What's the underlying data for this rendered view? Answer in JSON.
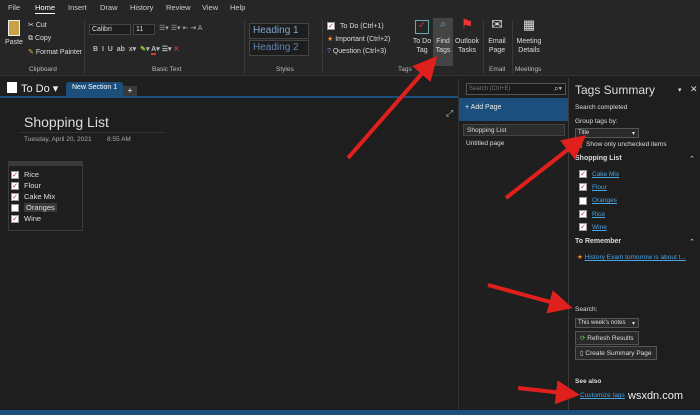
{
  "menu": [
    "File",
    "Home",
    "Insert",
    "Draw",
    "History",
    "Review",
    "View",
    "Help"
  ],
  "clipboard": {
    "paste": "Paste",
    "cut": "Cut",
    "copy": "Copy",
    "format_painter": "Format Painter",
    "label": "Clipboard"
  },
  "basic_text": {
    "font": "Calibri",
    "size": "11",
    "label": "Basic Text"
  },
  "styles": {
    "h1": "Heading 1",
    "h2": "Heading 2",
    "label": "Styles"
  },
  "tags": {
    "items": [
      "To Do (Ctrl+1)",
      "Important (Ctrl+2)",
      "Question (Ctrl+3)"
    ],
    "todo_tag": "To Do Tag",
    "find_tags": "Find Tags",
    "outlook_tasks": "Outlook Tasks",
    "label": "Tags"
  },
  "email": {
    "button": "Email Page",
    "label": "Email"
  },
  "meetings": {
    "button": "Meeting Details",
    "label": "Meetings"
  },
  "notebook": {
    "name": "To Do",
    "section": "New Section 1",
    "add": "+"
  },
  "search": {
    "placeholder": "Search (Ctrl+E)"
  },
  "pages": {
    "add": "+ Add Page",
    "items": [
      "Shopping List",
      "Untitled page"
    ]
  },
  "note": {
    "title": "Shopping List",
    "date": "Tuesday, April 20, 2021",
    "time": "8:55 AM",
    "items": [
      {
        "text": "Rice",
        "checked": true
      },
      {
        "text": "Flour",
        "checked": true
      },
      {
        "text": "Cake Mix",
        "checked": true
      },
      {
        "text": "Oranges",
        "checked": false
      },
      {
        "text": "Wine",
        "checked": true
      }
    ]
  },
  "summary": {
    "title": "Tags Summary",
    "status": "Search completed",
    "group_label": "Group tags by:",
    "group_value": "Title",
    "unchecked_only": "Show only unchecked items",
    "group1": "Shopping List",
    "group1_items": [
      {
        "text": "Cake Mix",
        "checked": true
      },
      {
        "text": "Flour",
        "checked": true
      },
      {
        "text": "Oranges",
        "checked": false
      },
      {
        "text": "Rice",
        "checked": true
      },
      {
        "text": "Wine",
        "checked": true
      }
    ],
    "group2": "To Remember",
    "group2_item": "History Exam tomorrow is about t...",
    "search_label": "Search:",
    "search_value": "This week's notes",
    "refresh": "Refresh Results",
    "create": "Create Summary Page",
    "see_also": "See also",
    "customize": "Customize tags"
  },
  "watermark": "wsxdn.com"
}
